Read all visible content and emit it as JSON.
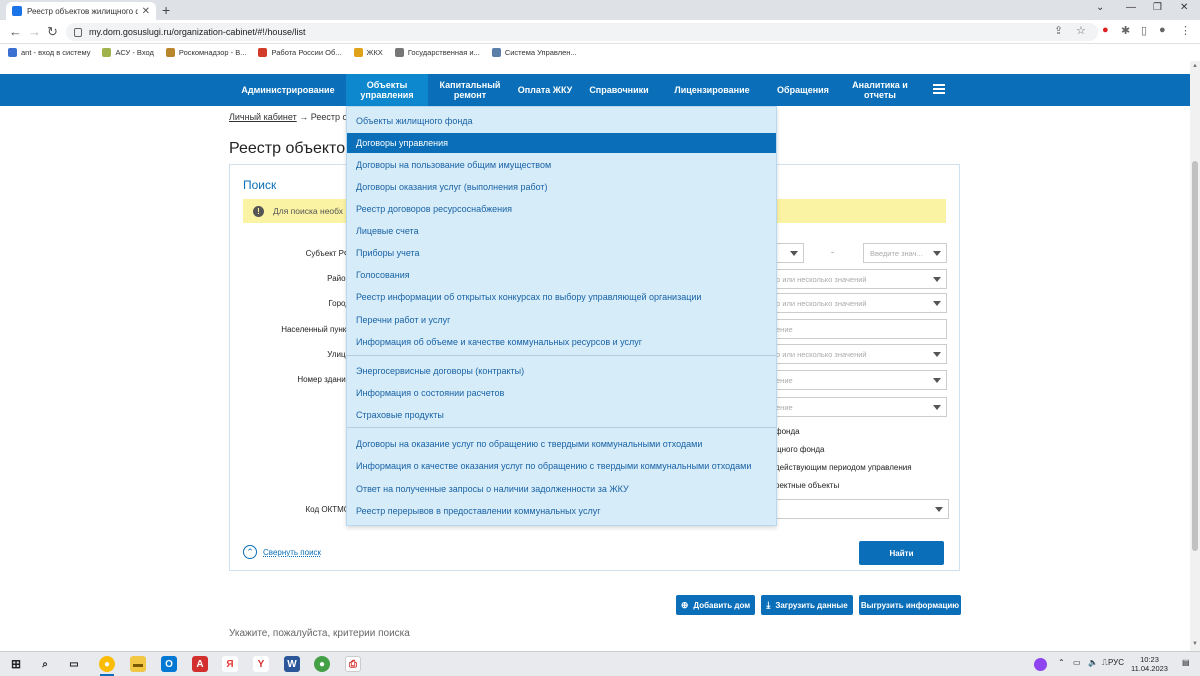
{
  "browser": {
    "tab_title": "Реестр объектов жилищного ф...",
    "url": "my.dom.gosuslugi.ru/organization-cabinet/#!/house/list",
    "bookmarks": [
      "ant - вход в систему",
      "АСУ - Вход",
      "Роскомнадзор - В...",
      "Работа России Об...",
      "ЖКХ",
      "Государственная и...",
      "Система Управлен..."
    ]
  },
  "topnav": {
    "items": [
      "Администрирование",
      "Объекты управления",
      "Капитальный ремонт",
      "Оплата ЖКУ",
      "Справочники",
      "Лицензирование",
      "Обращения",
      "Аналитика и отчеты"
    ]
  },
  "breadcrumb": {
    "home": "Личный кабинет",
    "arrow": "→",
    "current": "Реестр о"
  },
  "page_title": "Реестр объектов ж",
  "search": {
    "title": "Поиск",
    "warning": "Для поиска необх",
    "labels": {
      "subject": "Субъект РФ",
      "district": "Район",
      "city": "Город",
      "settlement": "Населенный пункт",
      "street": "Улица",
      "house_number": "Номер здания",
      "oktmo": "Код ОКТМО"
    },
    "placeholders": {
      "enter_value": "Введите знач...",
      "one_or_more": "о или несколько значений",
      "value": "ение",
      "dash": "-"
    },
    "checkbox_texts": [
      "фонда",
      "щного фонда",
      "действующим периодом управления",
      "ректные объекты"
    ],
    "collapse": "Свернуть поиск",
    "find_button": "Найти"
  },
  "actions": {
    "add_house": "Добавить дом",
    "upload_data": "Загрузить данные",
    "export_info": "Выгрузить информацию"
  },
  "hint": "Укажите, пожалуйста, критерии поиска",
  "dropdown": {
    "items": [
      "Объекты жилищного фонда",
      "Договоры управления",
      "Договоры на пользование общим имуществом",
      "Договоры оказания услуг (выполнения работ)",
      "Реестр договоров ресурсоснабжения",
      "Лицевые счета",
      "Приборы учета",
      "Голосования",
      "Реестр информации об открытых конкурсах по выбору управляющей организации",
      "Перечни работ и услуг",
      "Информация об объеме и качестве коммунальных ресурсов и услуг",
      "Энергосервисные договоры (контракты)",
      "Информация о состоянии расчетов",
      "Страховые продукты",
      "Договоры на оказание услуг по обращению с твердыми коммунальными отходами",
      "Информация о качестве оказания услуг по обращению с твердыми коммунальными отходами",
      "Ответ на полученные запросы о наличии задолженности за ЖКУ",
      "Реестр перерывов в предоставлении коммунальных услуг"
    ],
    "selected_index": 1
  },
  "taskbar": {
    "lang": "РУС",
    "time": "10:23",
    "date": "11.04.2023"
  },
  "colors": {
    "nav_blue": "#0a6fb8",
    "dropdown_bg": "#d6ecf9",
    "warning_bg": "#fbf3a4"
  }
}
